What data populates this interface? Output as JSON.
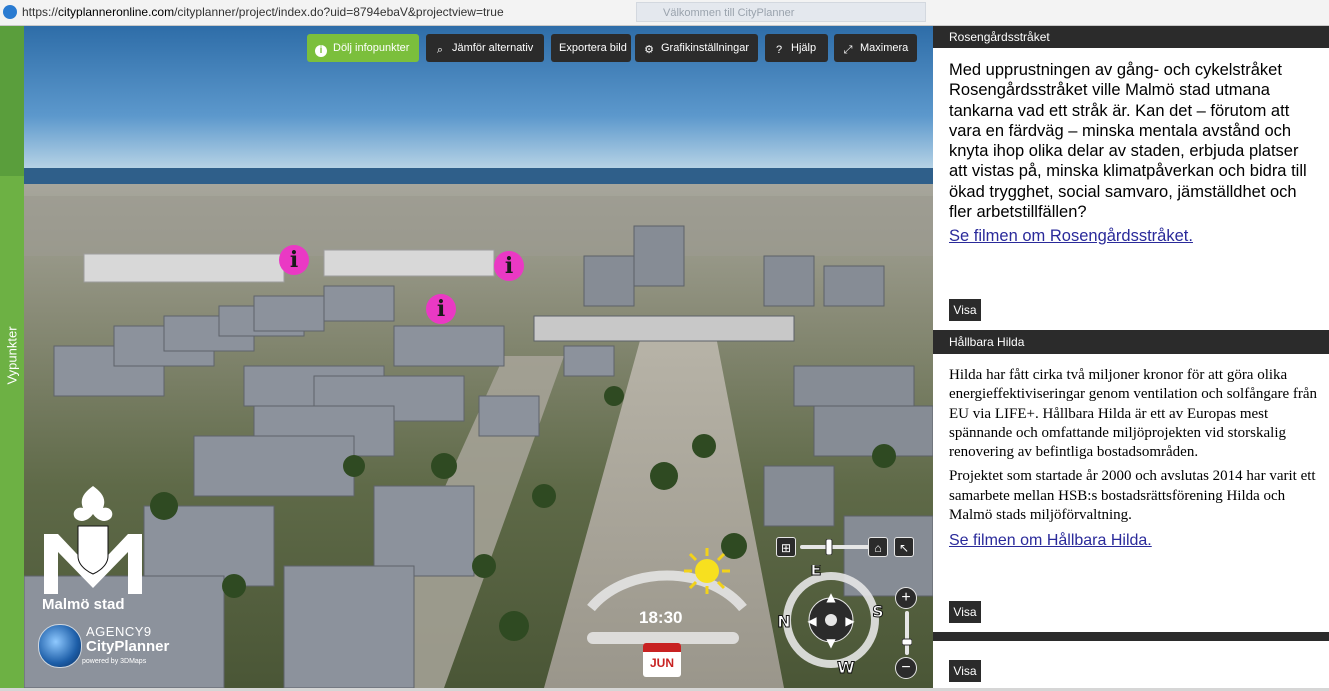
{
  "browser": {
    "url_prefix": "https://",
    "url_host": "cityplanneronline.com",
    "url_path": "/cityplanner/project/index.do?uid=8794ebaV&projectview=true",
    "background_tab": "Välkommen till CityPlanner"
  },
  "sidebar": {
    "label": "Vypunkter"
  },
  "toolbar": {
    "hide_infopoints": "Dölj infopunkter",
    "compare": "Jämför alternativ",
    "export": "Exportera bild",
    "graphics": "Grafikinställningar",
    "help": "Hjälp",
    "maximize": "Maximera"
  },
  "info_pins": [
    "i",
    "i",
    "i"
  ],
  "branding": {
    "malmo": "Malmö stad",
    "agency": "AGENCY9",
    "product": "CityPlanner",
    "powered": "powered by 3DMaps"
  },
  "time_widget": {
    "time": "18:30",
    "month": "JUN"
  },
  "nav_widget": {
    "compass": [
      "N",
      "E",
      "S",
      "W"
    ]
  },
  "panel": {
    "cards": [
      {
        "title": "Rosengårdsstråket",
        "paragraphs": [
          "Med upprustningen av gång- och cykelstråket Rosengårdsstråket ville Malmö stad utmana tankarna vad ett stråk är. Kan det – förutom att vara en färdväg – minska mentala avstånd och knyta ihop olika delar av staden, erbjuda platser att vistas på, minska klimatpåverkan och bidra till ökad trygghet, social samvaro, jämställdhet och fler arbetstillfällen?"
        ],
        "link": "Se filmen om Rosengårdsstråket.",
        "button": "Visa"
      },
      {
        "title": "Hållbara Hilda",
        "paragraphs": [
          "Hilda har fått cirka två miljoner kronor för att göra olika energieffektiviseringar genom ventilation och solfångare från EU via LIFE+. Hållbara Hilda är ett av Europas mest spännande och omfattande miljöprojekten vid storskalig renovering av befintliga bostadsområden.",
          "Projektet som startade år 2000 och avslutas 2014 har varit ett samarbete mellan HSB:s bostadsrättsförening Hilda och Malmö stads miljöförvaltning."
        ],
        "link": "Se filmen om Hållbara Hilda.",
        "button": "Visa"
      },
      {
        "title": "",
        "button": "Visa"
      }
    ]
  },
  "colors": {
    "accent_green": "#7bbf3c",
    "sidebar_green": "#5a9e3c",
    "pin_pink": "#ea39c4",
    "dark_bar": "#2b2b2b",
    "link": "#2a2a9a"
  }
}
